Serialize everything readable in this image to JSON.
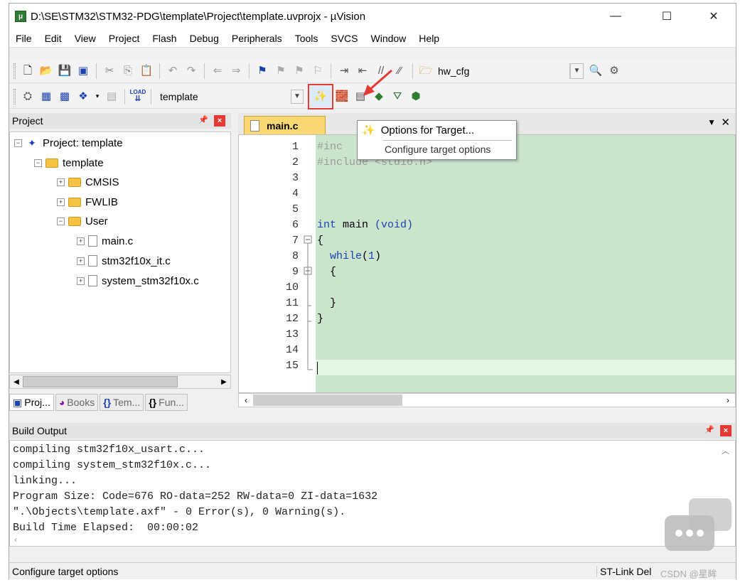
{
  "window": {
    "title": "D:\\SE\\STM32\\STM32-PDG\\template\\Project\\template.uvprojx - µVision",
    "minimize": "—",
    "maximize": "☐",
    "close": "✕"
  },
  "menu": [
    "File",
    "Edit",
    "View",
    "Project",
    "Flash",
    "Debug",
    "Peripherals",
    "Tools",
    "SVCS",
    "Window",
    "Help"
  ],
  "toolbar1": {
    "config_combo": "hw_cfg"
  },
  "toolbar2": {
    "target_combo": "template",
    "load_label": "LOAD"
  },
  "project_panel": {
    "title": "Project",
    "root": "Project: template",
    "target": "template",
    "groups": [
      "CMSIS",
      "FWLIB",
      "User"
    ],
    "files": [
      "main.c",
      "stm32f10x_it.c",
      "system_stm32f10x.c"
    ],
    "tabs": [
      "Proj...",
      "Books",
      "Tem...",
      "Fun..."
    ]
  },
  "editor": {
    "tab": "main.c",
    "lines": [
      "1",
      "2",
      "3",
      "4",
      "5",
      "6",
      "7",
      "8",
      "9",
      "10",
      "11",
      "12",
      "13",
      "14",
      "15"
    ],
    "code": {
      "l1": "#inc",
      "l2a": "#include ",
      "l2b": "<stdio.h>",
      "l6a": "int",
      "l6b": " main ",
      "l6c": "(void)",
      "l7": "{",
      "l8a": "  while",
      "l8b": "(",
      "l8c": "1",
      "l8d": ")",
      "l9": "  {",
      "l11": "  }",
      "l12": "}"
    }
  },
  "tooltip": {
    "title": "Options for Target...",
    "description": "Configure target options"
  },
  "build_output": {
    "title": "Build Output",
    "lines": [
      "compiling stm32f10x_usart.c...",
      "compiling system_stm32f10x.c...",
      "linking...",
      "Program Size: Code=676 RO-data=252 RW-data=0 ZI-data=1632",
      "\".\\Objects\\template.axf\" - 0 Error(s), 0 Warning(s).",
      "Build Time Elapsed:  00:00:02"
    ]
  },
  "status_bar": {
    "left": "Configure target options",
    "right": "ST-Link Del",
    "watermark": "CSDN @星眸"
  },
  "colors": {
    "highlight_border": "#e53935",
    "editor_bg": "#cbe5cd",
    "tab_active": "#f9d873"
  }
}
